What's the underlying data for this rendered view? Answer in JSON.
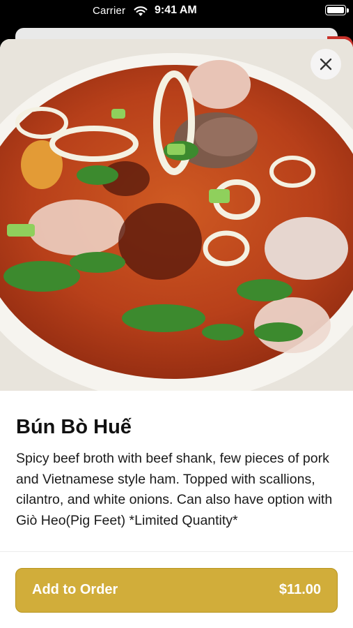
{
  "status_bar": {
    "carrier": "Carrier",
    "time": "9:41 AM"
  },
  "item": {
    "name": "Bún Bò Huế",
    "description": "Spicy beef broth with beef shank, few pieces of pork and Vietnamese style ham. Topped with scallions, cilantro, and white onions. Can also have option with Giò Heo(Pig Feet) *Limited Quantity*",
    "image_subject": "bowl of spicy beef noodle soup"
  },
  "actions": {
    "close_icon": "close-icon",
    "add_label": "Add to Order",
    "price": "$11.00"
  },
  "colors": {
    "accent": "#d1ad3a",
    "accent_border": "#b8951f",
    "broth": "#c0461b",
    "background": "#ffffff"
  }
}
